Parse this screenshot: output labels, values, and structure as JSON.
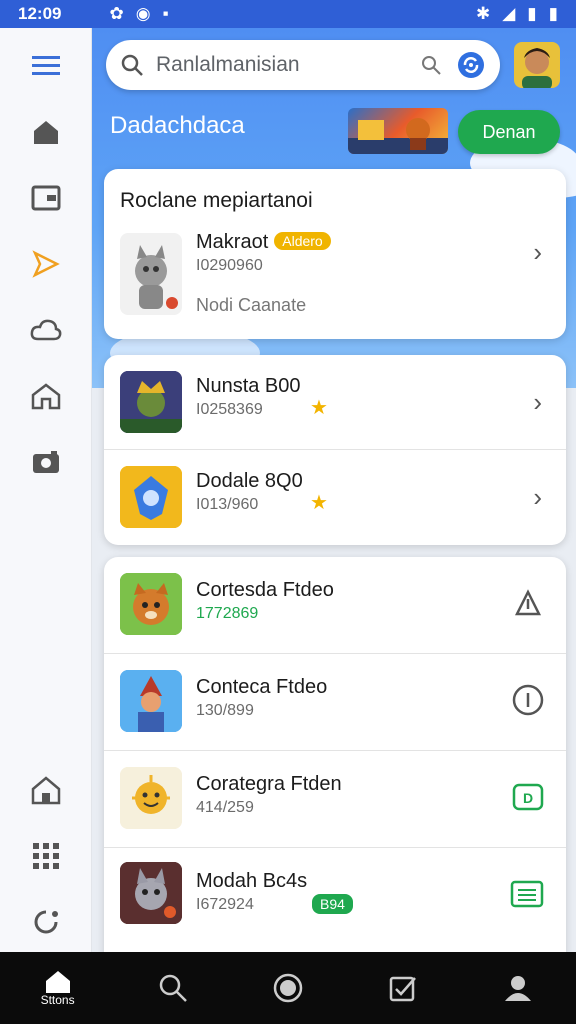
{
  "status": {
    "time": "12:09"
  },
  "search": {
    "query": "Ranlalmanisian"
  },
  "header": {
    "section_title": "Dadachdaca",
    "primary_button": "Denan"
  },
  "featured": {
    "heading": "Roclane mepiartanoi",
    "item": {
      "name": "Makraot",
      "badge": "Aldero",
      "code": "I0290960",
      "note": "Nodi Caanate"
    }
  },
  "list_a": [
    {
      "name": "Nunsta B00",
      "code": "I0258369"
    },
    {
      "name": "Dodale 8Q0",
      "code": "I013/960"
    }
  ],
  "list_b": [
    {
      "name": "Cortesda Ftdeo",
      "code": "1772869",
      "action_icon": "share-icon"
    },
    {
      "name": "Conteca Ftdeo",
      "code": "130/899",
      "action_icon": "info-icon"
    },
    {
      "name": "Corategra Ftden",
      "code": "414/259",
      "action_icon": "badge-d-icon"
    },
    {
      "name": "Modah Bc4s",
      "code": "I672924",
      "badge": "B94",
      "action_icon": "list-icon"
    }
  ],
  "bottom_nav": {
    "home_label": "Sttons"
  },
  "colors": {
    "accent_green": "#1fa84f",
    "accent_blue": "#2f5fd6",
    "star": "#f3b400"
  }
}
